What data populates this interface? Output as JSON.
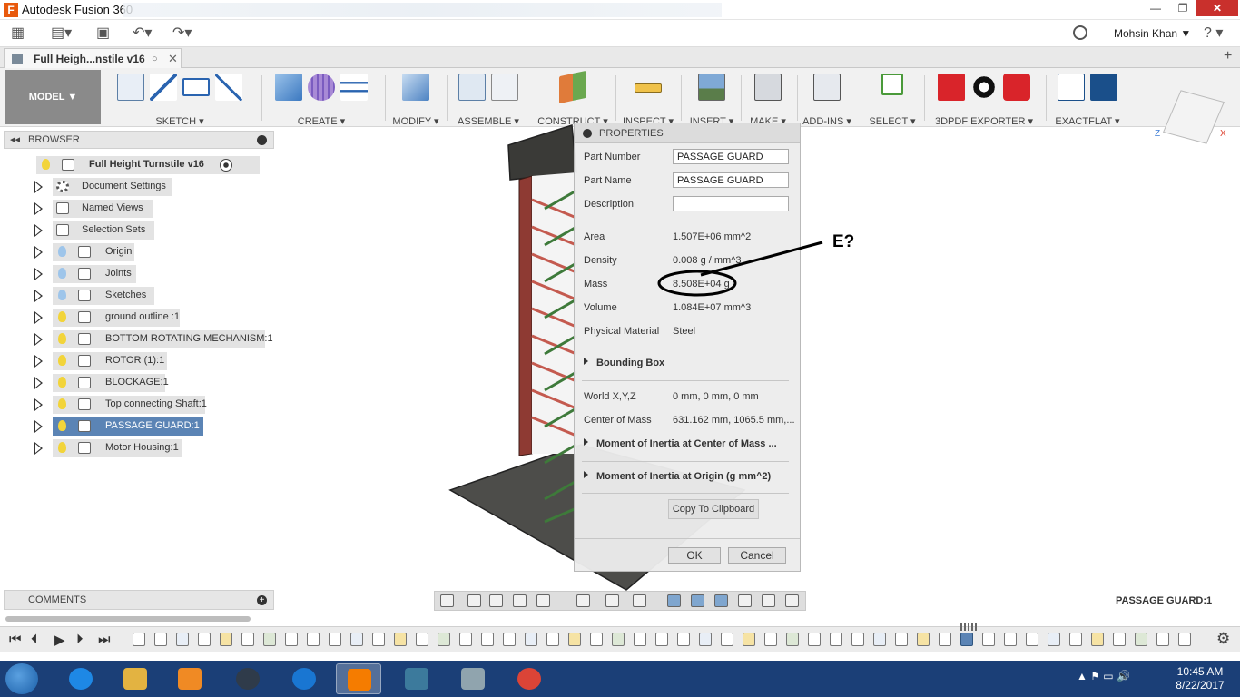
{
  "window": {
    "title": "Autodesk Fusion 360",
    "controls": {
      "minimize": "—",
      "maximize": "❐",
      "close": "✕"
    }
  },
  "qat": {
    "user_name": "Mohsin Khan ▼",
    "help": "? ▾"
  },
  "document_tab": {
    "name": "Full Heigh...nstile v16",
    "close": "✕",
    "new_tab": "+"
  },
  "ribbon": {
    "workspace": "MODEL ▼",
    "groups": [
      {
        "label": "SKETCH ▾",
        "icons": [
          "sketch-create-icon",
          "arc-icon",
          "rectangle-icon",
          "spline-icon"
        ]
      },
      {
        "label": "CREATE ▾",
        "icons": [
          "extrude-icon",
          "sculpt-form-icon",
          "pattern-icon"
        ]
      },
      {
        "label": "MODIFY ▾",
        "icons": [
          "press-pull-icon"
        ]
      },
      {
        "label": "ASSEMBLE ▾",
        "icons": [
          "new-component-icon",
          "joint-icon"
        ]
      },
      {
        "label": "CONSTRUCT ▾",
        "icons": [
          "offset-plane-icon"
        ]
      },
      {
        "label": "INSPECT ▾",
        "icons": [
          "measure-icon"
        ]
      },
      {
        "label": "INSERT ▾",
        "icons": [
          "insert-image-icon"
        ]
      },
      {
        "label": "MAKE ▾",
        "icons": [
          "3d-print-icon"
        ]
      },
      {
        "label": "ADD-INS ▾",
        "icons": [
          "scripts-addins-icon"
        ]
      },
      {
        "label": "SELECT ▾",
        "icons": [
          "select-arrow-icon"
        ]
      },
      {
        "label": "3DPDF EXPORTER ▾",
        "icons": [
          "3dpdf-icon",
          "gears-icon",
          "pdf-settings-icon"
        ]
      },
      {
        "label": "EXACTFLAT ▾",
        "icons": [
          "exactflat-flatten-icon",
          "exactflat-export-icon"
        ]
      }
    ]
  },
  "viewcube": {
    "axis_z": "Z",
    "axis_x": "X"
  },
  "browser": {
    "title": "BROWSER",
    "collapse_glyph": "◂◂",
    "root": "Full Height Turnstile v16",
    "items": [
      {
        "label": "Document Settings",
        "icon": "gear-icon",
        "bulb": ""
      },
      {
        "label": "Named Views",
        "icon": "folder-icon",
        "bulb": ""
      },
      {
        "label": "Selection Sets",
        "icon": "folder-icon",
        "bulb": ""
      },
      {
        "label": "Origin",
        "icon": "folder-icon",
        "bulb": "#9ec5ea"
      },
      {
        "label": "Joints",
        "icon": "folder-icon",
        "bulb": "#9ec5ea"
      },
      {
        "label": "Sketches",
        "icon": "folder-icon",
        "bulb": "#9ec5ea"
      },
      {
        "label": "ground outline :1",
        "icon": "component-icon",
        "bulb": "#f2d43a"
      },
      {
        "label": "BOTTOM ROTATING MECHANISM:1",
        "icon": "component-icon",
        "bulb": "#f2d43a"
      },
      {
        "label": "ROTOR (1):1",
        "icon": "component-icon",
        "bulb": "#f2d43a"
      },
      {
        "label": "BLOCKAGE:1",
        "icon": "component-icon",
        "bulb": "#f2d43a"
      },
      {
        "label": "Top connecting Shaft:1",
        "icon": "component-icon",
        "bulb": "#f2d43a"
      },
      {
        "label": "PASSAGE GUARD:1",
        "icon": "component-icon",
        "bulb": "#f2d43a",
        "selected": true
      },
      {
        "label": "Motor Housing:1",
        "icon": "component-icon",
        "bulb": "#f2d43a"
      }
    ]
  },
  "comments": {
    "title": "COMMENTS"
  },
  "properties": {
    "title": "PROPERTIES",
    "part_number_label": "Part Number",
    "part_number": "PASSAGE GUARD",
    "part_name_label": "Part Name",
    "part_name": "PASSAGE GUARD",
    "description_label": "Description",
    "description": "",
    "area_label": "Area",
    "area": "1.507E+06 mm^2",
    "density_label": "Density",
    "density": "0.008 g / mm^3",
    "mass_label": "Mass",
    "mass": "8.508E+04 g",
    "volume_label": "Volume",
    "volume": "1.084E+07 mm^3",
    "material_label": "Physical Material",
    "material": "Steel",
    "bounding_box": "Bounding Box",
    "world_label": "World X,Y,Z",
    "world": "0 mm, 0 mm, 0 mm",
    "com_label": "Center of Mass",
    "com": "631.162 mm, 1065.5 mm,...",
    "moi_center": "Moment of Inertia at Center of Mass ...",
    "moi_origin": "Moment of Inertia at Origin   (g mm^2)",
    "copy_btn": "Copy To Clipboard",
    "ok": "OK",
    "cancel": "Cancel"
  },
  "annotation": {
    "text": "E?"
  },
  "status": {
    "selection": "PASSAGE GUARD:1"
  },
  "timeline": {
    "controls": {
      "first": "⏮",
      "prev": "⏴",
      "play": "▶",
      "next": "⏵",
      "last": "⏭"
    },
    "gear": "⚙"
  },
  "taskbar": {
    "tray": "▲  ⚑  ▭  🔊",
    "time": "10:45 AM",
    "date": "8/22/2017",
    "apps": [
      {
        "name": "ie",
        "color": "#1e88e5"
      },
      {
        "name": "explorer",
        "color": "#e3b341"
      },
      {
        "name": "media",
        "color": "#f08a24"
      },
      {
        "name": "mu",
        "color": "#2f3b4a"
      },
      {
        "name": "c-app",
        "color": "#1976d2"
      },
      {
        "name": "fusion",
        "color": "#f57c00",
        "active": true
      },
      {
        "name": "ds2017",
        "color": "#3c7a9c"
      },
      {
        "name": "calculator",
        "color": "#90a4ae"
      },
      {
        "name": "chrome",
        "color": "#db4437"
      }
    ]
  }
}
